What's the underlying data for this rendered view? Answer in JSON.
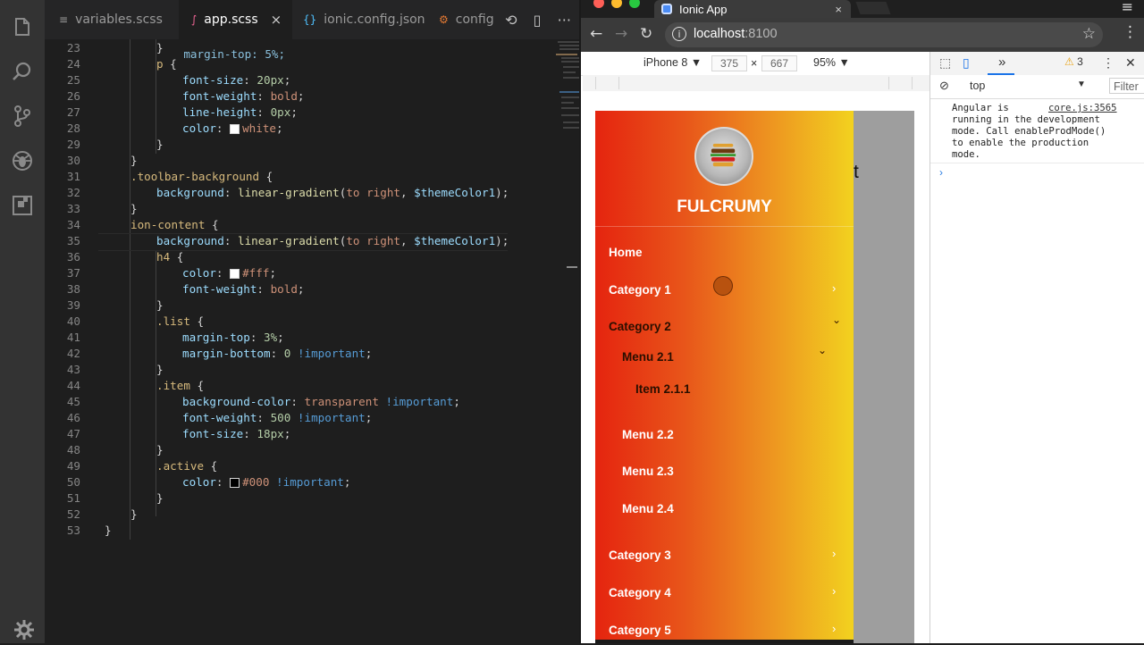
{
  "editor": {
    "tabs": [
      {
        "label": "variables.scss",
        "icon": "≡",
        "icon_color": "#9a9a9a",
        "active": false
      },
      {
        "label": "app.scss",
        "icon": "∫",
        "icon_color": "#f06595",
        "active": true
      },
      {
        "label": "ionic.config.json",
        "icon": "{}",
        "icon_color": "#4fc1ff",
        "active": false
      },
      {
        "label": "config",
        "icon": "⚙",
        "icon_color": "#e37933",
        "active": false
      }
    ],
    "close_glyph": "×",
    "actions": {
      "find_icon": "⟲",
      "split_icon": "▯",
      "more_icon": "···"
    },
    "partial_top_line": "    margin-top: 5%;",
    "lines": [
      {
        "n": "23",
        "indent": 2,
        "tokens": [
          {
            "t": "}",
            "c": "br"
          }
        ]
      },
      {
        "n": "24",
        "indent": 2,
        "tokens": [
          {
            "t": "p",
            "c": "sel"
          },
          {
            "t": " {",
            "c": "br"
          }
        ]
      },
      {
        "n": "25",
        "indent": 3,
        "tokens": [
          {
            "t": "font-size",
            "c": "prop"
          },
          {
            "t": ": ",
            "c": "br"
          },
          {
            "t": "20px",
            "c": "num"
          },
          {
            "t": ";",
            "c": "br"
          }
        ]
      },
      {
        "n": "26",
        "indent": 3,
        "tokens": [
          {
            "t": "font-weight",
            "c": "prop"
          },
          {
            "t": ": ",
            "c": "br"
          },
          {
            "t": "bold",
            "c": "str"
          },
          {
            "t": ";",
            "c": "br"
          }
        ]
      },
      {
        "n": "27",
        "indent": 3,
        "tokens": [
          {
            "t": "line-height",
            "c": "prop"
          },
          {
            "t": ": ",
            "c": "br"
          },
          {
            "t": "0px",
            "c": "num"
          },
          {
            "t": ";",
            "c": "br"
          }
        ]
      },
      {
        "n": "28",
        "indent": 3,
        "tokens": [
          {
            "t": "color",
            "c": "prop"
          },
          {
            "t": ": ",
            "c": "br"
          },
          {
            "t": "swatch:#ffffff",
            "c": "sw"
          },
          {
            "t": "white",
            "c": "str"
          },
          {
            "t": ";",
            "c": "br"
          }
        ]
      },
      {
        "n": "29",
        "indent": 2,
        "tokens": [
          {
            "t": "}",
            "c": "br"
          }
        ]
      },
      {
        "n": "30",
        "indent": 1,
        "tokens": [
          {
            "t": "}",
            "c": "br"
          }
        ]
      },
      {
        "n": "31",
        "indent": 1,
        "tokens": [
          {
            "t": ".toolbar-background",
            "c": "sel"
          },
          {
            "t": " {",
            "c": "br"
          }
        ]
      },
      {
        "n": "32",
        "indent": 2,
        "tokens": [
          {
            "t": "background",
            "c": "prop"
          },
          {
            "t": ": ",
            "c": "br"
          },
          {
            "t": "linear-gradient",
            "c": "fn"
          },
          {
            "t": "(",
            "c": "br"
          },
          {
            "t": "to right",
            "c": "str"
          },
          {
            "t": ", ",
            "c": "br"
          },
          {
            "t": "$themeColor1",
            "c": "var"
          },
          {
            "t": ");",
            "c": "br"
          }
        ]
      },
      {
        "n": "33",
        "indent": 1,
        "tokens": [
          {
            "t": "}",
            "c": "br"
          }
        ]
      },
      {
        "n": "34",
        "indent": 1,
        "tokens": [
          {
            "t": "ion-content",
            "c": "sel"
          },
          {
            "t": " {",
            "c": "br"
          }
        ]
      },
      {
        "n": "35",
        "indent": 2,
        "tokens": [
          {
            "t": "background",
            "c": "prop"
          },
          {
            "t": ": ",
            "c": "br"
          },
          {
            "t": "linear-gradient",
            "c": "fn"
          },
          {
            "t": "(",
            "c": "br"
          },
          {
            "t": "to right",
            "c": "str"
          },
          {
            "t": ", ",
            "c": "br"
          },
          {
            "t": "$themeColor1",
            "c": "var"
          },
          {
            "t": ");",
            "c": "br"
          }
        ]
      },
      {
        "n": "36",
        "indent": 2,
        "tokens": [
          {
            "t": "h4",
            "c": "sel"
          },
          {
            "t": " {",
            "c": "br"
          }
        ]
      },
      {
        "n": "37",
        "indent": 3,
        "tokens": [
          {
            "t": "color",
            "c": "prop"
          },
          {
            "t": ": ",
            "c": "br"
          },
          {
            "t": "swatch:#ffffff",
            "c": "sw"
          },
          {
            "t": "#fff",
            "c": "str"
          },
          {
            "t": ";",
            "c": "br"
          }
        ]
      },
      {
        "n": "38",
        "indent": 3,
        "tokens": [
          {
            "t": "font-weight",
            "c": "prop"
          },
          {
            "t": ": ",
            "c": "br"
          },
          {
            "t": "bold",
            "c": "str"
          },
          {
            "t": ";",
            "c": "br"
          }
        ]
      },
      {
        "n": "39",
        "indent": 2,
        "tokens": [
          {
            "t": "}",
            "c": "br"
          }
        ]
      },
      {
        "n": "40",
        "indent": 2,
        "tokens": [
          {
            "t": ".list",
            "c": "sel"
          },
          {
            "t": " {",
            "c": "br"
          }
        ]
      },
      {
        "n": "41",
        "indent": 3,
        "tokens": [
          {
            "t": "margin-top",
            "c": "prop"
          },
          {
            "t": ": ",
            "c": "br"
          },
          {
            "t": "3%",
            "c": "num"
          },
          {
            "t": ";",
            "c": "br"
          }
        ]
      },
      {
        "n": "42",
        "indent": 3,
        "tokens": [
          {
            "t": "margin-bottom",
            "c": "prop"
          },
          {
            "t": ": ",
            "c": "br"
          },
          {
            "t": "0",
            "c": "num"
          },
          {
            "t": " ",
            "c": "br"
          },
          {
            "t": "!important",
            "c": "kw"
          },
          {
            "t": ";",
            "c": "br"
          }
        ]
      },
      {
        "n": "43",
        "indent": 2,
        "tokens": [
          {
            "t": "}",
            "c": "br"
          }
        ]
      },
      {
        "n": "44",
        "indent": 2,
        "tokens": [
          {
            "t": ".item",
            "c": "sel"
          },
          {
            "t": " {",
            "c": "br"
          }
        ]
      },
      {
        "n": "45",
        "indent": 3,
        "tokens": [
          {
            "t": "background-color",
            "c": "prop"
          },
          {
            "t": ": ",
            "c": "br"
          },
          {
            "t": "transparent",
            "c": "str"
          },
          {
            "t": " ",
            "c": "br"
          },
          {
            "t": "!important",
            "c": "kw"
          },
          {
            "t": ";",
            "c": "br"
          }
        ]
      },
      {
        "n": "46",
        "indent": 3,
        "tokens": [
          {
            "t": "font-weight",
            "c": "prop"
          },
          {
            "t": ": ",
            "c": "br"
          },
          {
            "t": "500",
            "c": "num"
          },
          {
            "t": " ",
            "c": "br"
          },
          {
            "t": "!important",
            "c": "kw"
          },
          {
            "t": ";",
            "c": "br"
          }
        ]
      },
      {
        "n": "47",
        "indent": 3,
        "tokens": [
          {
            "t": "font-size",
            "c": "prop"
          },
          {
            "t": ": ",
            "c": "br"
          },
          {
            "t": "18px",
            "c": "num"
          },
          {
            "t": ";",
            "c": "br"
          }
        ]
      },
      {
        "n": "48",
        "indent": 2,
        "tokens": [
          {
            "t": "}",
            "c": "br"
          }
        ]
      },
      {
        "n": "49",
        "indent": 2,
        "tokens": [
          {
            "t": ".active",
            "c": "sel"
          },
          {
            "t": " {",
            "c": "br"
          }
        ]
      },
      {
        "n": "50",
        "indent": 3,
        "tokens": [
          {
            "t": "color",
            "c": "prop"
          },
          {
            "t": ": ",
            "c": "br"
          },
          {
            "t": "swatch:#000000",
            "c": "sw"
          },
          {
            "t": "#000",
            "c": "str"
          },
          {
            "t": " ",
            "c": "br"
          },
          {
            "t": "!important",
            "c": "kw"
          },
          {
            "t": ";",
            "c": "br"
          }
        ]
      },
      {
        "n": "51",
        "indent": 2,
        "tokens": [
          {
            "t": "}",
            "c": "br"
          }
        ]
      },
      {
        "n": "52",
        "indent": 1,
        "tokens": [
          {
            "t": "}",
            "c": "br"
          }
        ]
      },
      {
        "n": "53",
        "indent": 0,
        "tokens": [
          {
            "t": "}",
            "c": "br"
          }
        ]
      }
    ]
  },
  "browser": {
    "tab_title": "Ionic App",
    "tab_close": "×",
    "url_host": "localhost",
    "url_port": ":8100",
    "device": "iPhone 8 ▼",
    "width": "375",
    "height": "667",
    "dim_sep": "×",
    "zoom": "95% ▼",
    "peek_text": "t"
  },
  "app": {
    "brand": "FULCRUMY",
    "menu": [
      {
        "label": "Home",
        "level": 0,
        "chevron": ""
      },
      {
        "label": "Category 1",
        "level": 0,
        "chevron": "›"
      },
      {
        "label": "Category 2",
        "level": 0,
        "chevron": "⌄",
        "dark": true
      },
      {
        "label": "Menu 2.1",
        "level": 1,
        "chevron": "⌄",
        "dark": true
      },
      {
        "label": "Item 2.1.1",
        "level": 2,
        "chevron": "",
        "dark": true
      },
      {
        "label": "Menu 2.2",
        "level": 1,
        "chevron": ""
      },
      {
        "label": "Menu 2.3",
        "level": 1,
        "chevron": ""
      },
      {
        "label": "Menu 2.4",
        "level": 1,
        "chevron": ""
      },
      {
        "label": "Category 3",
        "level": 0,
        "chevron": "›"
      },
      {
        "label": "Category 4",
        "level": 0,
        "chevron": "›"
      },
      {
        "label": "Category 5",
        "level": 0,
        "chevron": "›"
      }
    ]
  },
  "devtools": {
    "more_tabs": "»",
    "warning_count": "3",
    "context": "top",
    "filter_placeholder": "Filter",
    "log_message": "Angular is\nrunning in the development\nmode. Call enableProdMode()\nto enable the production\nmode.",
    "log_source": "core.js:3565",
    "prompt_glyph": "›"
  }
}
